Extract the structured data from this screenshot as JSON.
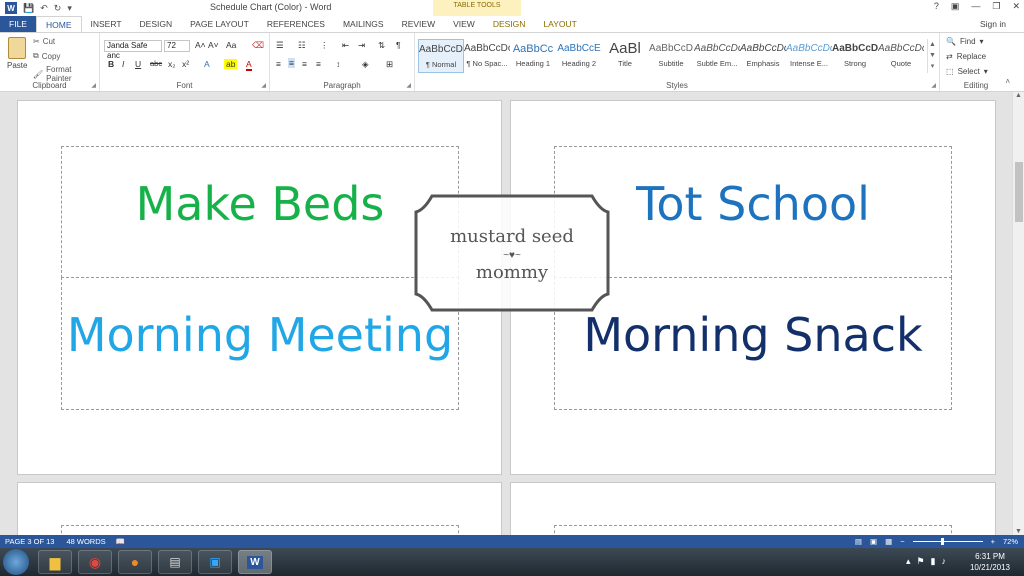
{
  "titlebar": {
    "title": "Schedule Chart (Color) - Word",
    "table_tools": "TABLE TOOLS",
    "help": "?",
    "min": "—",
    "restore": "❐",
    "close": "✕"
  },
  "tabs": [
    "FILE",
    "HOME",
    "INSERT",
    "DESIGN",
    "PAGE LAYOUT",
    "REFERENCES",
    "MAILINGS",
    "REVIEW",
    "VIEW",
    "DESIGN",
    "LAYOUT"
  ],
  "signin": "Sign in",
  "clipboard": {
    "paste": "Paste",
    "cut": "Cut",
    "copy": "Copy",
    "format_painter": "Format Painter",
    "label": "Clipboard"
  },
  "font": {
    "name": "Janda Safe anc",
    "size": "72",
    "grow": "A˄",
    "shrink": "A˅",
    "case": "Aa",
    "bold": "B",
    "italic": "I",
    "underline": "U",
    "strike": "abc",
    "sub": "x₂",
    "sup": "x²",
    "label": "Font"
  },
  "paragraph": {
    "label": "Paragraph"
  },
  "styles": {
    "label": "Styles",
    "items": [
      {
        "preview": "AaBbCcDc",
        "name": "¶ Normal"
      },
      {
        "preview": "AaBbCcDc",
        "name": "¶ No Spac..."
      },
      {
        "preview": "AaBbCc",
        "name": "Heading 1"
      },
      {
        "preview": "AaBbCcE",
        "name": "Heading 2"
      },
      {
        "preview": "AaBl",
        "name": "Title"
      },
      {
        "preview": "AaBbCcD",
        "name": "Subtitle"
      },
      {
        "preview": "AaBbCcDc",
        "name": "Subtle Em..."
      },
      {
        "preview": "AaBbCcDc",
        "name": "Emphasis"
      },
      {
        "preview": "AaBbCcDc",
        "name": "Intense E..."
      },
      {
        "preview": "AaBbCcDc",
        "name": "Strong"
      },
      {
        "preview": "AaBbCcDc",
        "name": "Quote"
      }
    ]
  },
  "editing": {
    "find": "Find",
    "replace": "Replace",
    "select": "Select",
    "label": "Editing"
  },
  "cards": {
    "make_beds": "Make Beds",
    "tot_school": "Tot School",
    "morning_meeting": "Morning Meeting",
    "morning_snack": "Morning Snack"
  },
  "watermark": {
    "line1": "mustard seed",
    "line2": "mommy"
  },
  "status": {
    "page": "PAGE 3 OF 13",
    "words": "48 WORDS",
    "zoom": "72%"
  },
  "clock": {
    "time": "6:31 PM",
    "date": "10/21/2013"
  },
  "colors": {
    "word_blue": "#2b579a",
    "green": "#17b14a",
    "mid_blue": "#1e73be",
    "light_blue": "#22a7e6",
    "navy": "#13306b"
  }
}
